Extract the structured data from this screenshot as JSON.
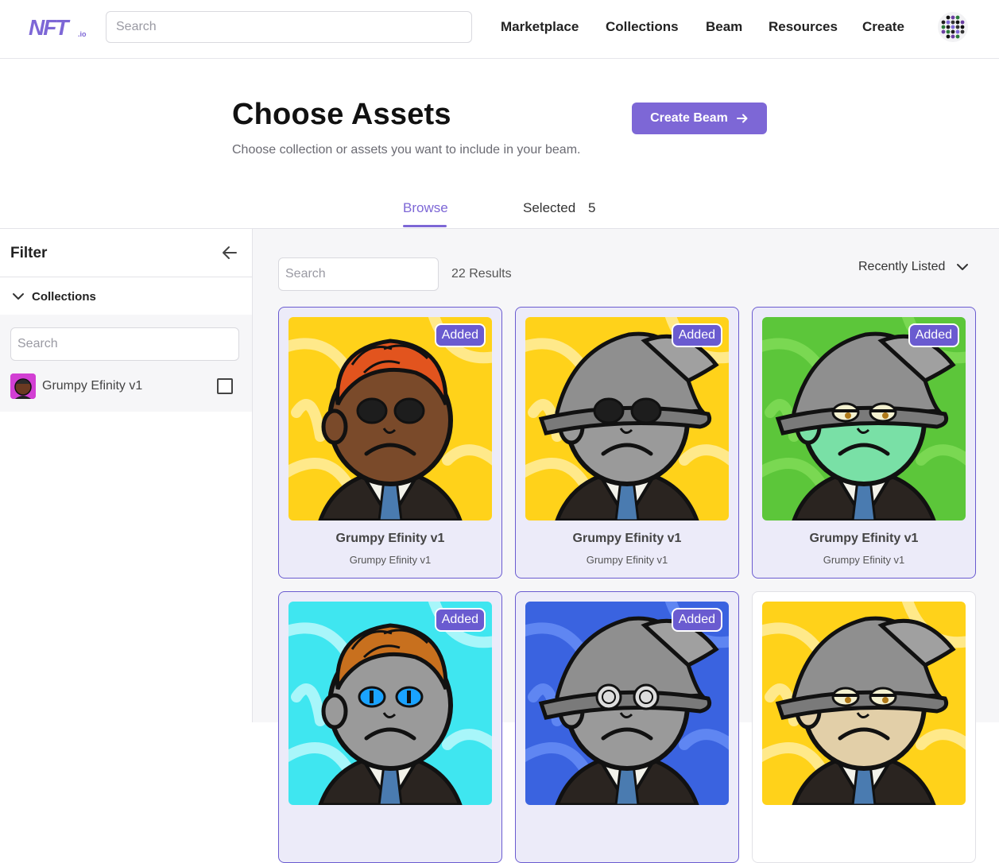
{
  "header": {
    "logo_text": "NFT.io",
    "search_placeholder": "Search",
    "nav": [
      "Marketplace",
      "Collections",
      "Beam",
      "Resources",
      "Create"
    ]
  },
  "hero": {
    "title": "Choose Assets",
    "subtitle": "Choose collection or assets you want to include in your beam.",
    "create_button": "Create Beam"
  },
  "tabs": {
    "browse": "Browse",
    "selected": "Selected",
    "selected_count": "5"
  },
  "sidebar": {
    "title": "Filter",
    "section": "Collections",
    "search_placeholder": "Search",
    "collection_name": "Grumpy Efinity v1",
    "checked": false
  },
  "main": {
    "search_placeholder": "Search",
    "results": "22 Results",
    "sort": "Recently Listed"
  },
  "cards": [
    {
      "title": "Grumpy Efinity v1",
      "subtitle": "Grumpy Efinity v1",
      "badge": "Added",
      "bg": "#ffd21a",
      "face": "#7a4a2a",
      "hat": "hair",
      "hair": "#e2541e",
      "eyes": "shades"
    },
    {
      "title": "Grumpy Efinity v1",
      "subtitle": "Grumpy Efinity v1",
      "badge": "Added",
      "bg": "#ffd21a",
      "face": "#9a9a9a",
      "hat": "wizard",
      "eyes": "shades"
    },
    {
      "title": "Grumpy Efinity v1",
      "subtitle": "Grumpy Efinity v1",
      "badge": "Added",
      "bg": "#5cc63a",
      "face": "#79e0a6",
      "hat": "wizard",
      "eyes": "sleepy"
    },
    {
      "title": "",
      "subtitle": "",
      "badge": "Added",
      "bg": "#3fe6f0",
      "face": "#9a9a9a",
      "hat": "hair",
      "hair": "#c8701e",
      "eyes": "blue"
    },
    {
      "title": "",
      "subtitle": "",
      "badge": "Added",
      "bg": "#3a63e0",
      "face": "#9a9a9a",
      "hat": "wizard",
      "eyes": "spiral"
    },
    {
      "title": "",
      "subtitle": "",
      "badge": "",
      "bg": "#ffd21a",
      "face": "#e2cfa8",
      "hat": "wizard",
      "eyes": "sleepy"
    }
  ],
  "colors": {
    "accent": "#7d67d6",
    "card_border": "#6a5bd0",
    "card_selected_bg": "#ecebf9",
    "main_bg": "#f6f6f8"
  }
}
